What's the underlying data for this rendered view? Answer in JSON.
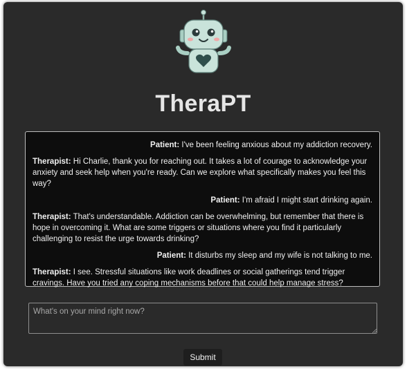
{
  "app": {
    "title": "TheraPT",
    "logo_icon": "robot-heart-icon"
  },
  "conversation": [
    {
      "role": "patient",
      "speaker": "Patient:",
      "text": "I've been feeling anxious about my addiction recovery."
    },
    {
      "role": "therapist",
      "speaker": "Therapist:",
      "text": "Hi Charlie, thank you for reaching out. It takes a lot of courage to acknowledge your anxiety and seek help when you're ready. Can we explore what specifically makes you feel this way?"
    },
    {
      "role": "patient",
      "speaker": "Patient:",
      "text": "I'm afraid I might start drinking again."
    },
    {
      "role": "therapist",
      "speaker": "Therapist:",
      "text": "That's understandable. Addiction can be overwhelming, but remember that there is hope in overcoming it. What are some triggers or situations where you find it particularly challenging to resist the urge towards drinking?"
    },
    {
      "role": "patient",
      "speaker": "Patient:",
      "text": "It disturbs my sleep and my wife is not talking to me."
    },
    {
      "role": "therapist",
      "speaker": "Therapist:",
      "text": "I see. Stressful situations like work deadlines or social gatherings tend trigger cravings. Have you tried any coping mechanisms before that could help manage stress?"
    }
  ],
  "input": {
    "value": "",
    "placeholder": "What's on your mind right now?"
  },
  "submit": {
    "label": "Submit"
  },
  "colors": {
    "background": "#2a2a2a",
    "chat_background": "#0d0d0d",
    "robot_body": "#c9e3da",
    "robot_dark": "#2f4f4c",
    "cheeks": "#f2a7a7"
  }
}
